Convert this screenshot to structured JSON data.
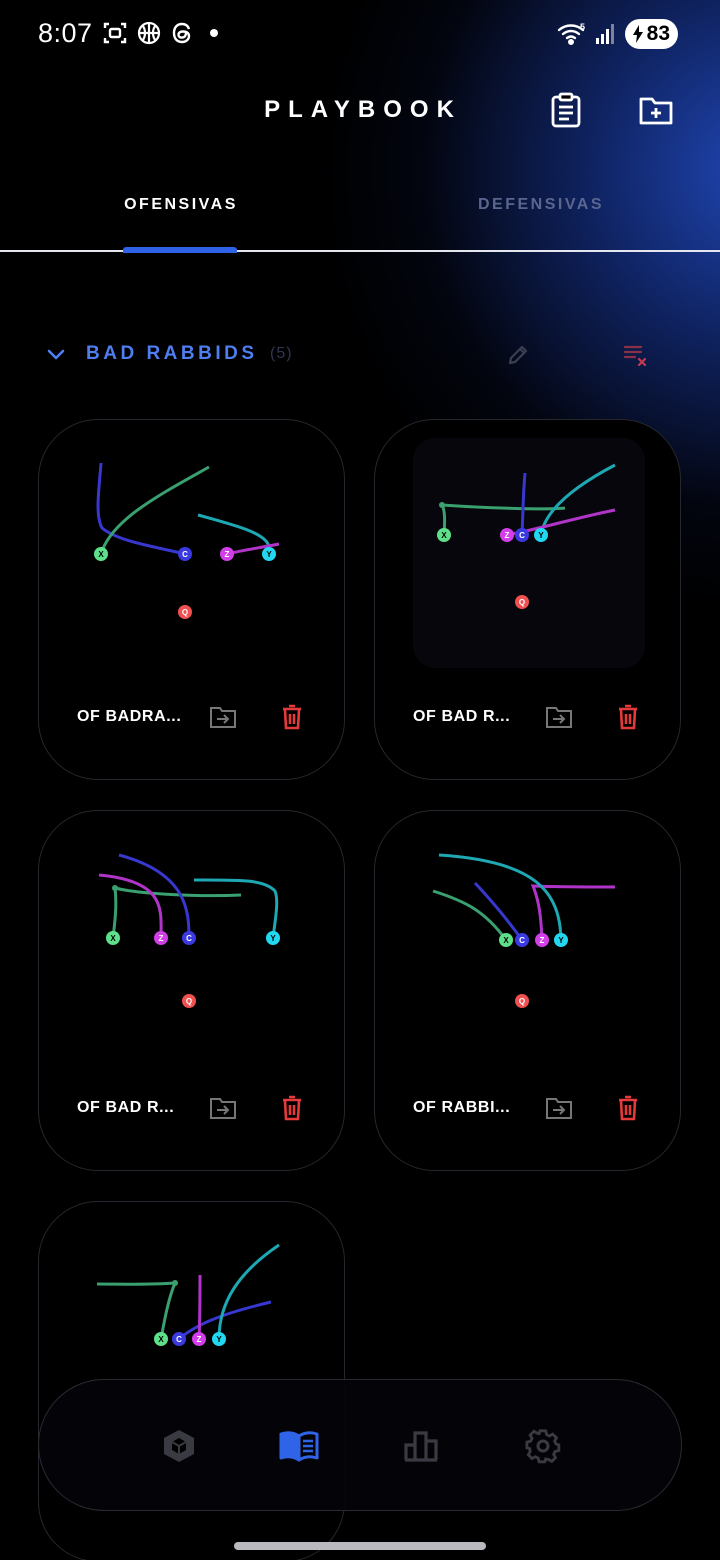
{
  "status": {
    "time": "8:07",
    "battery": "83",
    "wifi_badge": "5"
  },
  "header": {
    "title": "PLAYBOOK",
    "icons": [
      "clipboard-icon",
      "add-folder-icon"
    ]
  },
  "tabs": [
    {
      "label": "OFENSIVAS",
      "active": true
    },
    {
      "label": "DEFENSIVAS",
      "active": false
    }
  ],
  "group": {
    "title": "BAD RABBIDS",
    "count": "(5)",
    "icons": [
      "chevron-down-icon",
      "pencil-icon",
      "clear-list-icon"
    ]
  },
  "plays": [
    {
      "title": "OF BADRA..."
    },
    {
      "title": "OF BAD R..."
    },
    {
      "title": "OF BAD R..."
    },
    {
      "title": "OF RABBI..."
    },
    {
      "title": ""
    }
  ],
  "player_labels": {
    "x": "X",
    "c": "C",
    "z": "Z",
    "y": "Y",
    "q": "Q"
  },
  "colors": {
    "accent_blue": "#2f63e8",
    "group_title": "#4e7ef0",
    "delete_red": "#e53a3a",
    "x_green": "#5ee08a",
    "c_blue": "#3a3ae0",
    "z_magenta": "#d23ee8",
    "y_cyan": "#22d8f0",
    "q_red": "#f05050"
  },
  "bottom_nav": {
    "items": [
      {
        "icon": "cube-icon",
        "active": false
      },
      {
        "icon": "playbook-icon",
        "active": true
      },
      {
        "icon": "stats-icon",
        "active": false
      },
      {
        "icon": "settings-icon",
        "active": false
      }
    ]
  }
}
